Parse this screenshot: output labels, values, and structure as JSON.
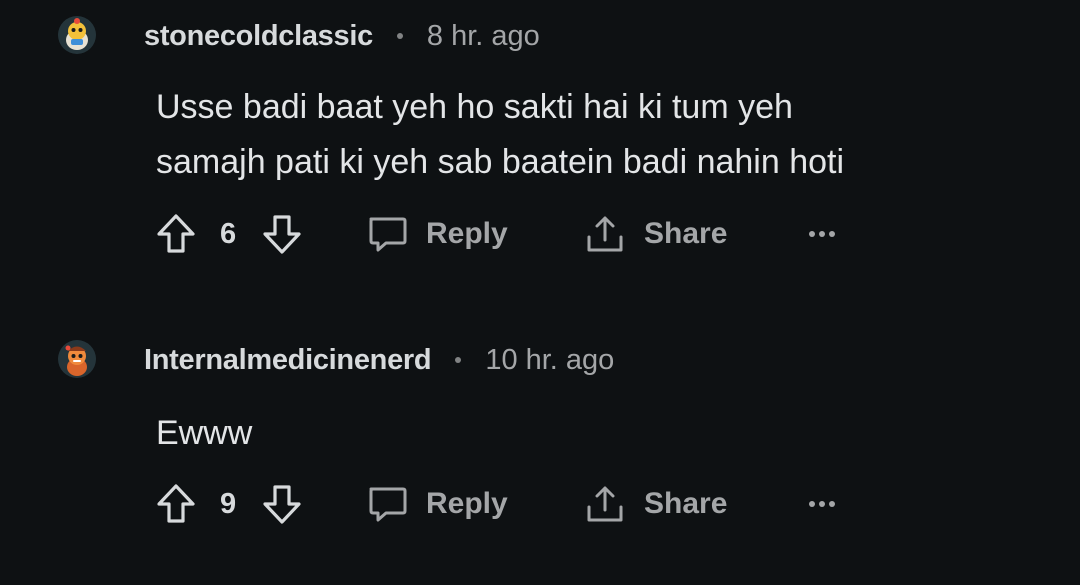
{
  "comments": [
    {
      "username": "stonecoldclassic",
      "time": "8 hr. ago",
      "body_lines": [
        "Usse badi baat yeh ho sakti hai ki tum yeh",
        "samajh pati ki yeh sab baatein badi nahin hoti"
      ],
      "score": "6",
      "reply_label": "Reply",
      "share_label": "Share",
      "avatar_icon": "snoo-avatar-icon"
    },
    {
      "username": "Internalmedicinenerd",
      "time": "10 hr. ago",
      "body_lines": [
        "Ewww"
      ],
      "score": "9",
      "reply_label": "Reply",
      "share_label": "Share",
      "avatar_icon": "snoo-avatar-icon"
    }
  ],
  "colors": {
    "background": "#0e1113",
    "text": "#d7dadc",
    "muted": "#a4a6a8"
  },
  "icons": {
    "upvote": "upvote-arrow-icon",
    "downvote": "downvote-arrow-icon",
    "reply": "speech-bubble-icon",
    "share": "share-upload-icon",
    "more": "ellipsis-icon"
  }
}
